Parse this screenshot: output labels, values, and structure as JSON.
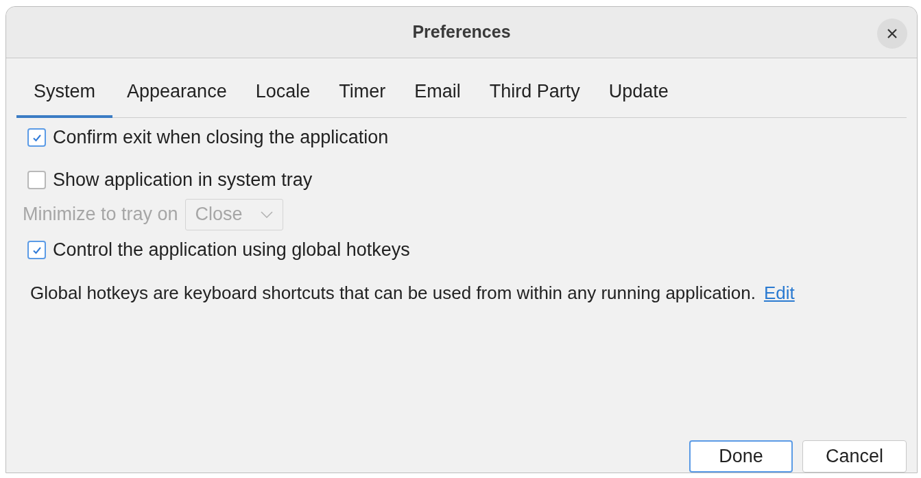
{
  "window": {
    "title": "Preferences"
  },
  "tabs": [
    {
      "label": "System",
      "selected": true
    },
    {
      "label": "Appearance",
      "selected": false
    },
    {
      "label": "Locale",
      "selected": false
    },
    {
      "label": "Timer",
      "selected": false
    },
    {
      "label": "Email",
      "selected": false
    },
    {
      "label": "Third Party",
      "selected": false
    },
    {
      "label": "Update",
      "selected": false
    }
  ],
  "settings": [
    {
      "kind": "checkbox",
      "label": "Confirm exit when closing the application",
      "checked": true
    },
    {
      "kind": "checkbox",
      "label": "Show application in system tray",
      "checked": false
    },
    {
      "kind": "dropdown",
      "label": "Minimize to tray on",
      "value": "Close",
      "disabled": true
    },
    {
      "kind": "checkbox",
      "label": "Control the application using global hotkeys",
      "checked": true
    },
    {
      "kind": "note",
      "text": "Global hotkeys are keyboard shortcuts that can be used from within any running application.",
      "link": "Edit"
    }
  ],
  "buttons": [
    {
      "label": "Done",
      "default": true
    },
    {
      "label": "Cancel",
      "default": false
    }
  ]
}
